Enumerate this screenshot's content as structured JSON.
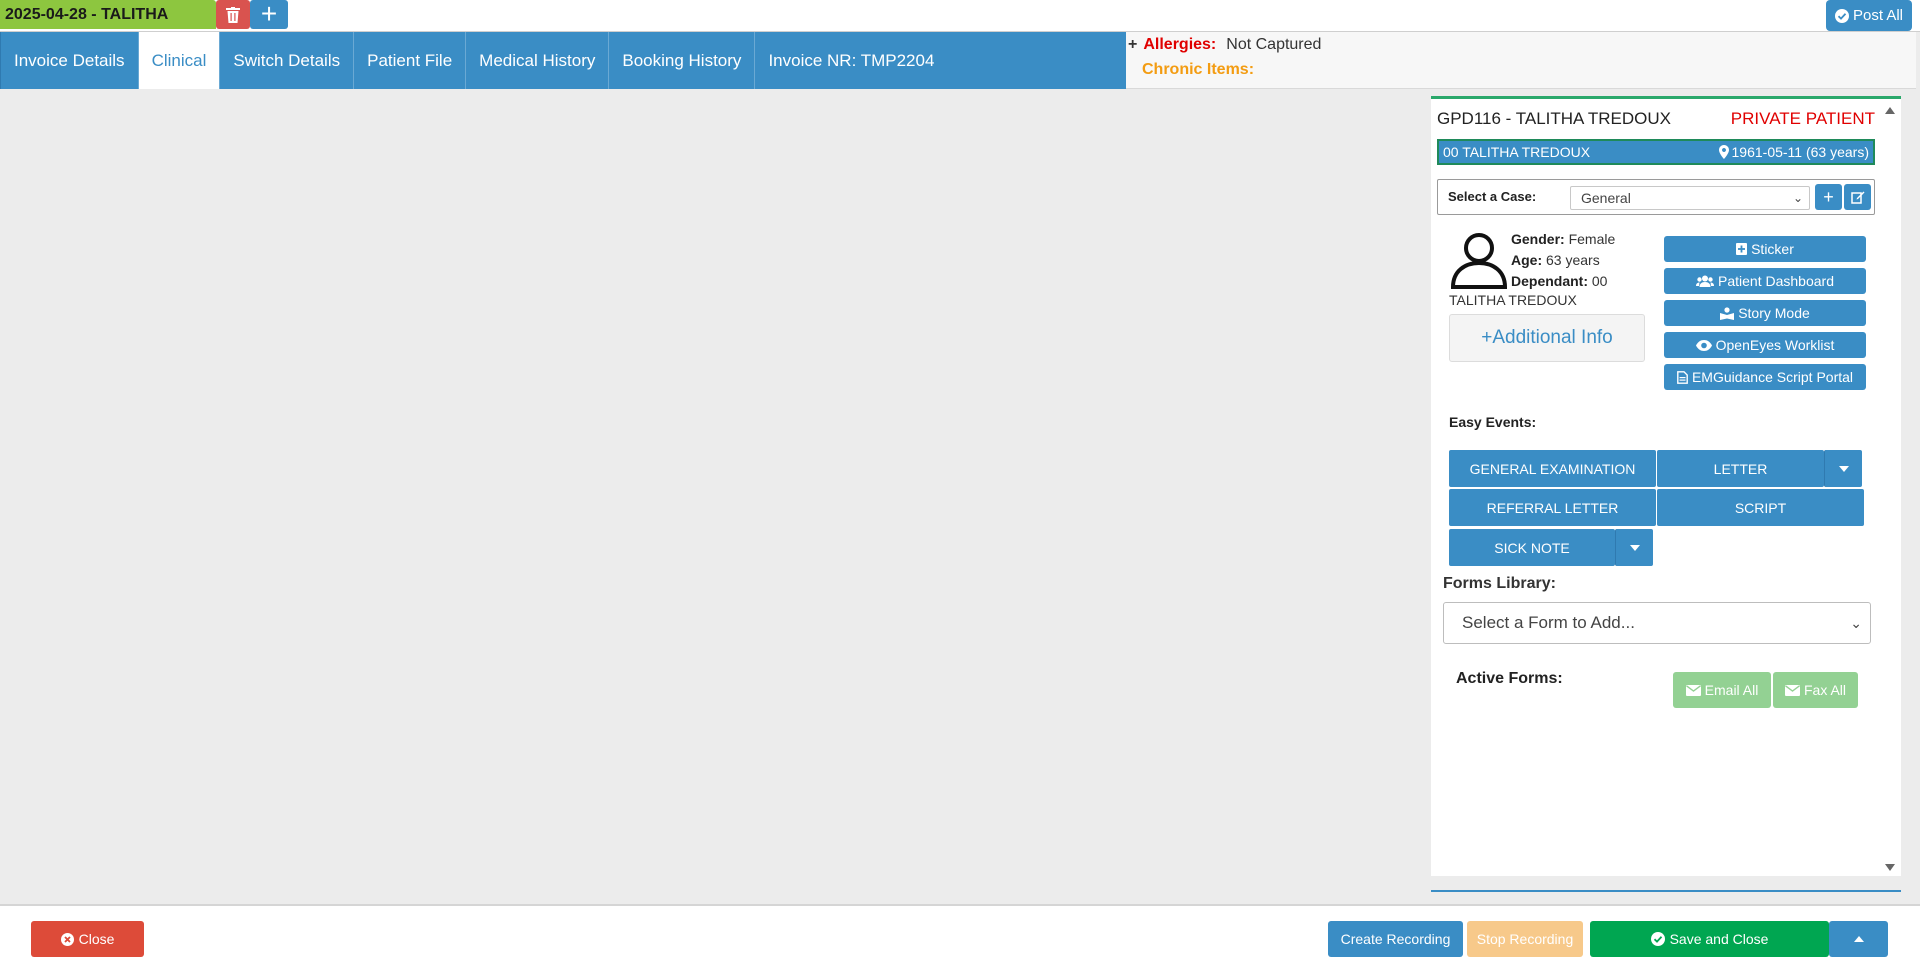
{
  "topbar": {
    "session_tab": "2025-04-28 - TALITHA",
    "post_all_label": "Post All"
  },
  "nav": {
    "tabs": [
      {
        "label": "Invoice Details",
        "active": false
      },
      {
        "label": "Clinical",
        "active": true
      },
      {
        "label": "Switch Details",
        "active": false
      },
      {
        "label": "Patient File",
        "active": false
      },
      {
        "label": "Medical History",
        "active": false
      },
      {
        "label": "Booking History",
        "active": false
      },
      {
        "label": "Invoice NR: TMP2204",
        "active": false
      }
    ]
  },
  "alerts": {
    "plus": "+",
    "allergies_label": "Allergies:",
    "allergies_value": "Not Captured",
    "chronic_label": "Chronic Items:"
  },
  "patient": {
    "title": "GPD116 - TALITHA TREDOUX",
    "type_label": "PRIVATE PATIENT",
    "bar_left": "00 TALITHA TREDOUX",
    "bar_right": "1961-05-11 (63 years)",
    "case_label": "Select a Case:",
    "case_value": "General",
    "gender_label": "Gender:",
    "gender_value": "Female",
    "age_label": "Age:",
    "age_value": "63 years",
    "dependant_label": "Dependant:",
    "dependant_value": "00",
    "name": "TALITHA TREDOUX",
    "additional_info": "+Additional Info"
  },
  "side_buttons": {
    "sticker": "Sticker",
    "patient_dashboard": "Patient Dashboard",
    "story_mode": "Story Mode",
    "openeyes_worklist": "OpenEyes Worklist",
    "emguidance": "EMGuidance Script Portal"
  },
  "easy_events": {
    "label": "Easy Events:",
    "general_examination": "GENERAL EXAMINATION",
    "letter": "LETTER",
    "referral_letter": "REFERRAL LETTER",
    "script": "SCRIPT",
    "sick_note": "SICK NOTE"
  },
  "forms": {
    "library_label": "Forms Library:",
    "select_placeholder": "Select a Form to Add...",
    "active_label": "Active Forms:",
    "email_all": "Email All",
    "fax_all": "Fax All"
  },
  "footer": {
    "close": "Close",
    "create_recording": "Create Recording",
    "stop_recording": "Stop Recording",
    "save_and_close": "Save and Close"
  },
  "colors": {
    "primary": "#3a8dc5",
    "success": "#00a651",
    "danger": "#d9534f",
    "session_tab": "#8dc63f",
    "allergy_red": "#e00000",
    "chronic_orange": "#f39c12"
  }
}
